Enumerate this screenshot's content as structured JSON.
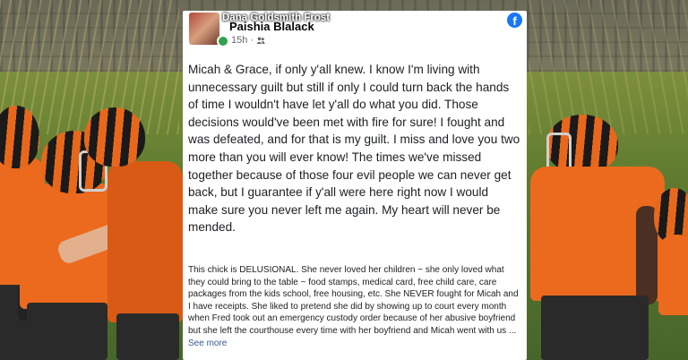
{
  "post": {
    "shared_by": "Dana Goldsmith Frost",
    "author": "Paishia Blalack",
    "time": "15h",
    "time_separator": "·",
    "audience_icon": "friends-icon",
    "network_icon": "facebook-logo-icon",
    "body": "Micah & Grace, if only y'all knew. I know I'm living with unnecessary guilt but still if only I could turn back the hands of time I wouldn't have let y'all do what you did. Those decisions would've been met with fire for sure! I fought and was defeated, and for that is my guilt. I miss and love you two more than you will ever know! The times we've missed together because of those four evil people we can never get back, but I guarantee if y'all were here right now I would make sure you never left me again. My heart will never be mended."
  },
  "comment": {
    "text": "This chick is DELUSIONAL. She never loved her children ~ she only loved what they could bring to the table ~ food stamps, medical card, free child care, care packages from the kids school, free housing, etc. She NEVER fought for Micah and I have receipts. She liked to pretend she did by showing up to court every month when Fred took out an emergency custody order because of her abusive boyfriend but she left the courthouse every time with her boyfriend and Micah went with us ... ",
    "see_more": "See more"
  },
  "colors": {
    "facebook_blue": "#1877f2",
    "online_green": "#31a24c",
    "jersey_orange": "#ec6a1e",
    "link_blue": "#385898"
  }
}
